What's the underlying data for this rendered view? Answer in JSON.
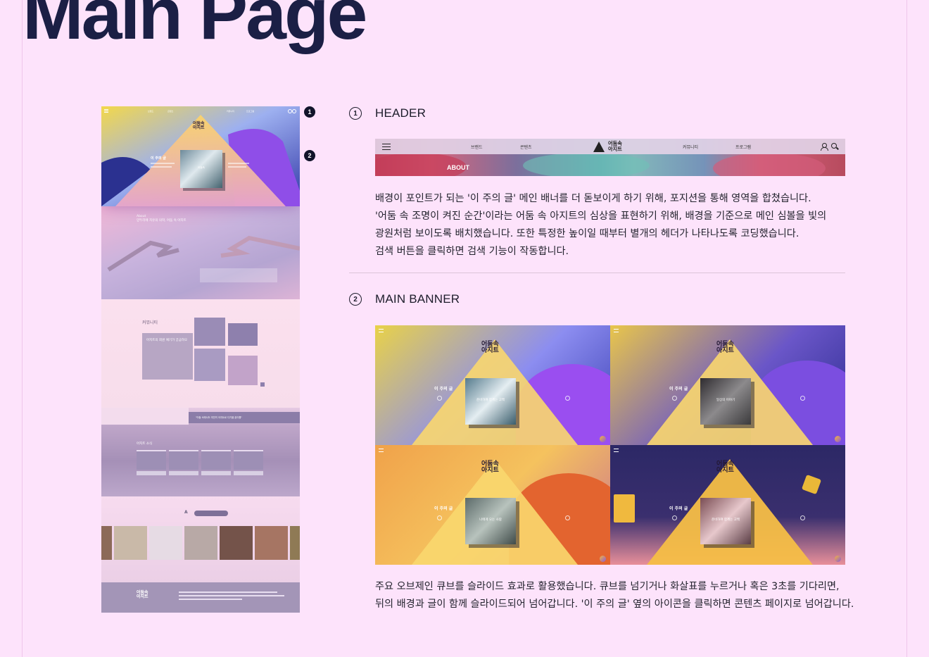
{
  "page": {
    "title": "Main Page"
  },
  "markers": [
    "1",
    "2"
  ],
  "preview": {
    "logo": "어둠속\n아지트",
    "nav": [
      "브랜드",
      "콘텐츠",
      "커뮤니티",
      "프로그램"
    ],
    "banner_caption": "이 주의 글",
    "cube_label": "어둠속",
    "about_title": "About\n양두리에 치유의 의학, 어둠 속 아지트",
    "community_title": "커뮤니티",
    "community_card": "아지트의 회원 얘기가 궁금하오",
    "sea_bar": "\"어둠 속에서도 여전히 아지트로 다가올 꿈이를\"",
    "sea_title": "아지트 소식",
    "footer_logo": "어둠속\n아지트"
  },
  "sections": [
    {
      "num": "1",
      "title": "HEADER",
      "description": [
        "배경이 포인트가 되는 '이 주의 글' 메인 배너를 더 돋보이게 하기 위해, 포지션을 통해 영역을 합쳤습니다.",
        "'어둠 속 조명이 켜진 순간'이라는 어둠 속 아지트의 심상을 표현하기 위해, 배경을 기준으로 메인 심볼을 빛의",
        "광원처럼 보이도록 배치했습니다. 또한 특정한 높이일 때부터 별개의 헤더가 나타나도록 코딩했습니다.",
        "검색 버튼을 클릭하면 검색 기능이 작동합니다."
      ]
    },
    {
      "num": "2",
      "title": "MAIN BANNER",
      "description": [
        "주요 오브제인 큐브를 슬라이드 효과로 활용했습니다. 큐브를 넘기거나 화살표를 누르거나 혹은 3초를 기다리면,",
        "뒤의 배경과 글이 함께 슬라이드되어 넘어갑니다. '이 주의 글' 옆의 아이콘을 클릭하면 콘텐츠 페이지로 넘어갑니다."
      ]
    }
  ],
  "header_shot": {
    "nav": [
      "브랜드",
      "콘텐츠",
      "커뮤니티",
      "프로그램"
    ],
    "logo": "어둠속\n아지트",
    "about": "ABOUT"
  },
  "banners": [
    {
      "caption": "이 주의 글",
      "cube_label": "준비하여 함께는 고백",
      "bg": [
        "#e9d248",
        "#8c8df0",
        "#3c3fb4"
      ]
    },
    {
      "caption": "이 주의 글",
      "cube_label": "일상의 이야기",
      "bg": [
        "#f3b54a",
        "#6a56c8",
        "#2f2a86"
      ]
    },
    {
      "caption": "이 주의 글",
      "cube_label": "나에게 오는 사람",
      "bg": [
        "#f0a24a",
        "#e46a3a",
        "#f7c35a"
      ]
    },
    {
      "caption": "이 주의 글",
      "cube_label": "준비하여 함께는 고백",
      "bg": [
        "#f2b441",
        "#2c2866",
        "#e88f9a"
      ]
    }
  ],
  "colors": {
    "background": "#fde3fb",
    "title": "#1b1f45",
    "text": "#24242f"
  }
}
